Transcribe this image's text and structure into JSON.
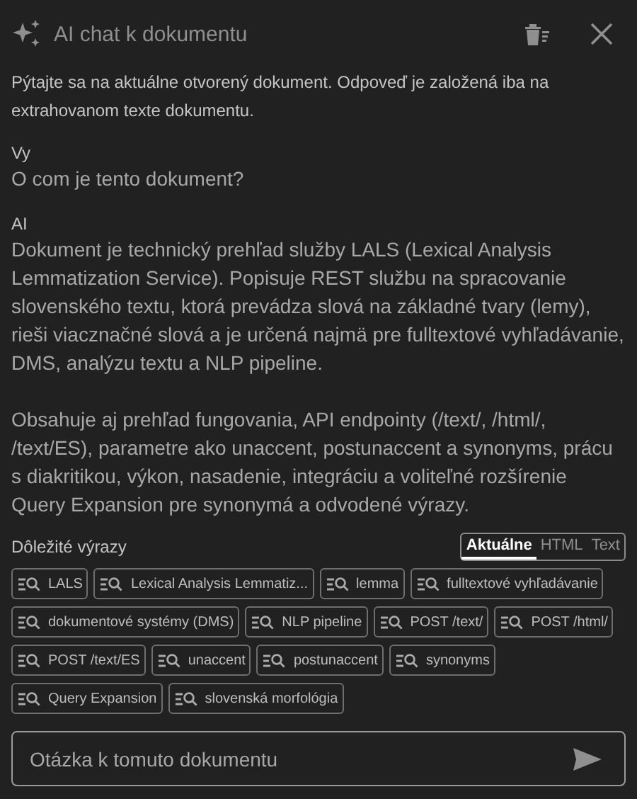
{
  "header": {
    "title": "AI chat k dokumentu"
  },
  "intro": "Pýtajte sa na aktuálne otvorený dokument. Odpoveď je založená iba na extrahovanom texte dokumentu.",
  "messages": [
    {
      "role": "Vy",
      "paragraphs": [
        "O com je tento dokument?"
      ]
    },
    {
      "role": "AI",
      "paragraphs": [
        "Dokument je technický prehľad služby LALS (Lexical Analysis Lemmatization Service). Popisuje REST službu na spracovanie slovenského textu, ktorá prevádza slová na základné tvary (lemy), rieši viacznačné slová a je určená najmä pre fulltextové vyhľadávanie, DMS, analýzu textu a NLP pipeline.",
        "Obsahuje aj prehľad fungovania, API endpointy (/text/, /html/, /text/ES), parametre ako unaccent, postunaccent a synonyms, prácu s diakritikou, výkon, nasadenie, integráciu a voliteľné rozšírenie Query Expansion pre synonymá a odvodené výrazy."
      ]
    }
  ],
  "terms": {
    "title": "Dôležité výrazy",
    "tabs": [
      {
        "label": "Aktuálne",
        "selected": true
      },
      {
        "label": "HTML",
        "selected": false
      },
      {
        "label": "Text",
        "selected": false
      }
    ],
    "chips": [
      "LALS",
      "Lexical Analysis Lemmatiz...",
      "lemma",
      "fulltextové vyhľadávanie",
      "dokumentové systémy (DMS)",
      "NLP pipeline",
      "POST /text/",
      "POST /html/",
      "POST /text/ES",
      "unaccent",
      "postunaccent",
      "synonyms",
      "Query Expansion",
      "slovenská morfológia"
    ]
  },
  "question": {
    "placeholder": "Otázka k tomuto dokumentu"
  }
}
